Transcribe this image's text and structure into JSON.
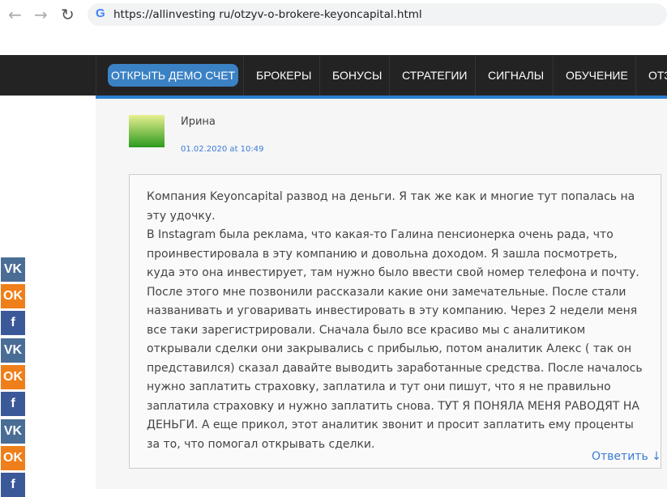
{
  "browser": {
    "url": "https://allinvesting ru/otzyv-o-brokere-keyoncapital.html"
  },
  "nav": {
    "items": [
      "ОТКРЫТЬ ДЕМО СЧЕТ",
      "БРОКЕРЫ",
      "БОНУСЫ",
      "СТРАТЕГИИ",
      "СИГНАЛЫ",
      "ОБУЧЕНИЕ",
      "ОТЗ"
    ]
  },
  "comment": {
    "author": "Ирина",
    "date": "01.02.2020 at 10:49",
    "text": "Компания Keyoncapital развод на деньги. Я так же как и многие тут попалась на эту удочку.\nВ Instagram была реклама, что какая-то Галина пенсионерка очень рада, что проинвестировала в эту компанию и довольна доходом. Я зашла посмотреть, куда это она инвестирует, там нужно было ввести свой номер телефона и почту. После этого мне позвонили рассказали какие они замечательные. После стали названивать и уговаривать инвестировать в эту компанию. Через 2 недели меня все таки зарегистрировали. Сначала было все красиво мы с аналитиком открывали сделки они закрывались с прибылью, потом аналитик Алекс ( так он представился) сказал давайте выводить заработанные средства. После началось нужно заплатить страховку, заплатила и тут они пишут, что я не правильно заплатила страховку и нужно заплатить снова. ТУТ Я ПОНЯЛА МЕНЯ РАВОДЯТ НА ДЕНЬГИ. А еще прикол, этот аналитик звонит и просит заплатить ему проценты за то, что помогал открывать сделки.",
    "reply": "Ответить ↓"
  },
  "social": {
    "vk": "VK",
    "ok": "OK",
    "fb": "f"
  }
}
